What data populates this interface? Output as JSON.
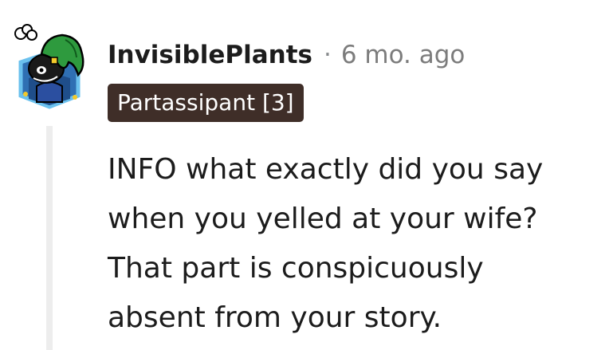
{
  "comment": {
    "author": "InvisiblePlants",
    "separator": "·",
    "timestamp": "6 mo. ago",
    "flair": "Partassipant [3]",
    "body_lines": [
      "INFO what exactly did you say",
      "when you yelled at your wife?",
      "That part is conspicuously",
      "absent from your story."
    ]
  },
  "colors": {
    "flair_background": "#3f2e28",
    "thread_line": "#ededed",
    "avatar_hair": "#2e9a3e",
    "avatar_border": "#3a9bdc"
  },
  "icons": {
    "avatar": "snoo-avatar-icon"
  }
}
